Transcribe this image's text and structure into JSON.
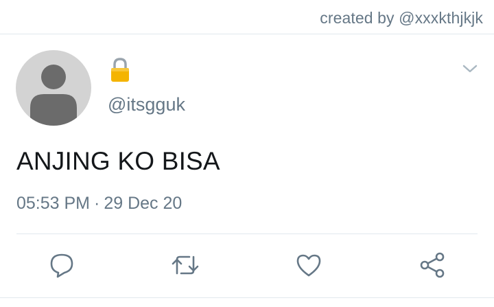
{
  "header": {
    "credit": "created by @xxxkthjkjk"
  },
  "tweet": {
    "handle": "@itsgguk",
    "text": "ANJING KO BISA",
    "time": "05:53 PM",
    "separator": "·",
    "date": "29 Dec 20",
    "protected_icon": "lock-icon",
    "menu_icon": "chevron-down-icon"
  },
  "actions": [
    {
      "name": "reply",
      "icon": "reply-icon"
    },
    {
      "name": "retweet",
      "icon": "retweet-icon"
    },
    {
      "name": "like",
      "icon": "heart-icon"
    },
    {
      "name": "share",
      "icon": "share-icon"
    }
  ],
  "colors": {
    "secondary_text": "#657786",
    "primary_text": "#14171a",
    "divider": "#e1e8ed",
    "avatar_bg": "#d3d3d3",
    "avatar_figure": "#6b6b6b",
    "lock_gold": "#f4b400"
  }
}
